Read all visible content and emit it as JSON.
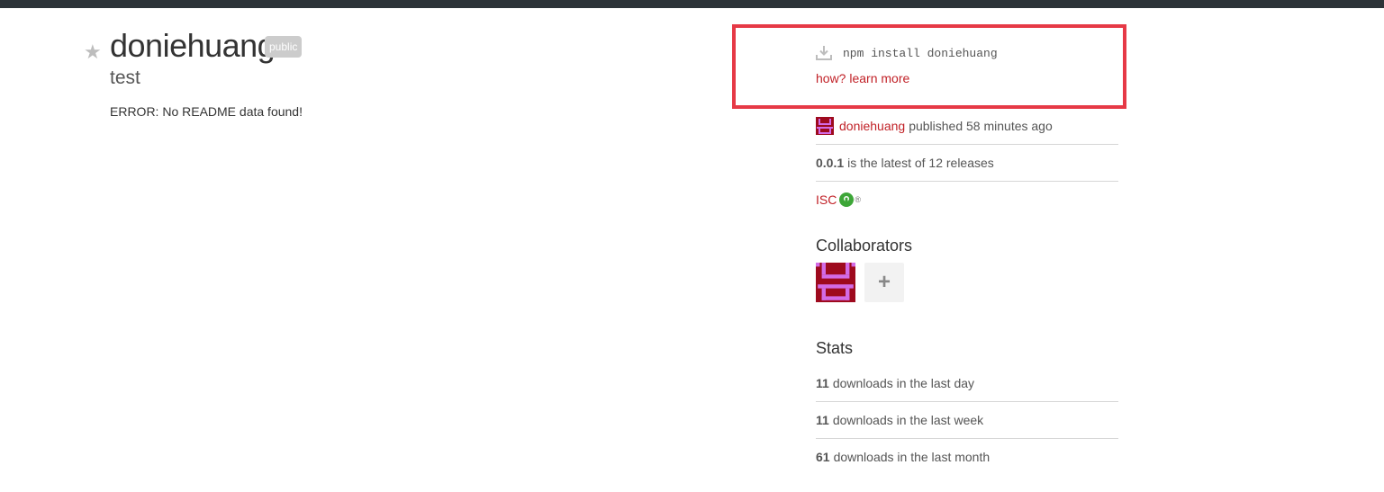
{
  "package": {
    "name": "doniehuang",
    "badge": "public",
    "description": "test",
    "readme_error": "ERROR: No README data found!",
    "star_icon": "star-icon"
  },
  "install": {
    "command": "npm install doniehuang",
    "help_link": "how? learn more",
    "icon": "download-icon"
  },
  "sidebar": {
    "publisher": {
      "user": "doniehuang",
      "text": "published 58 minutes ago"
    },
    "version": {
      "number": "0.0.1",
      "text": "is the latest of 12 releases"
    },
    "license": {
      "name": "ISC",
      "icon": "osi-icon",
      "mark": "®"
    }
  },
  "collaborators": {
    "title": "Collaborators",
    "add_label": "+"
  },
  "stats": {
    "title": "Stats",
    "rows": [
      {
        "count": "11",
        "text": "downloads in the last day"
      },
      {
        "count": "11",
        "text": "downloads in the last week"
      },
      {
        "count": "61",
        "text": "downloads in the last month"
      }
    ]
  },
  "colors": {
    "accent": "#c12127",
    "highlight_border": "#e63946",
    "topbar": "#2c3338"
  }
}
